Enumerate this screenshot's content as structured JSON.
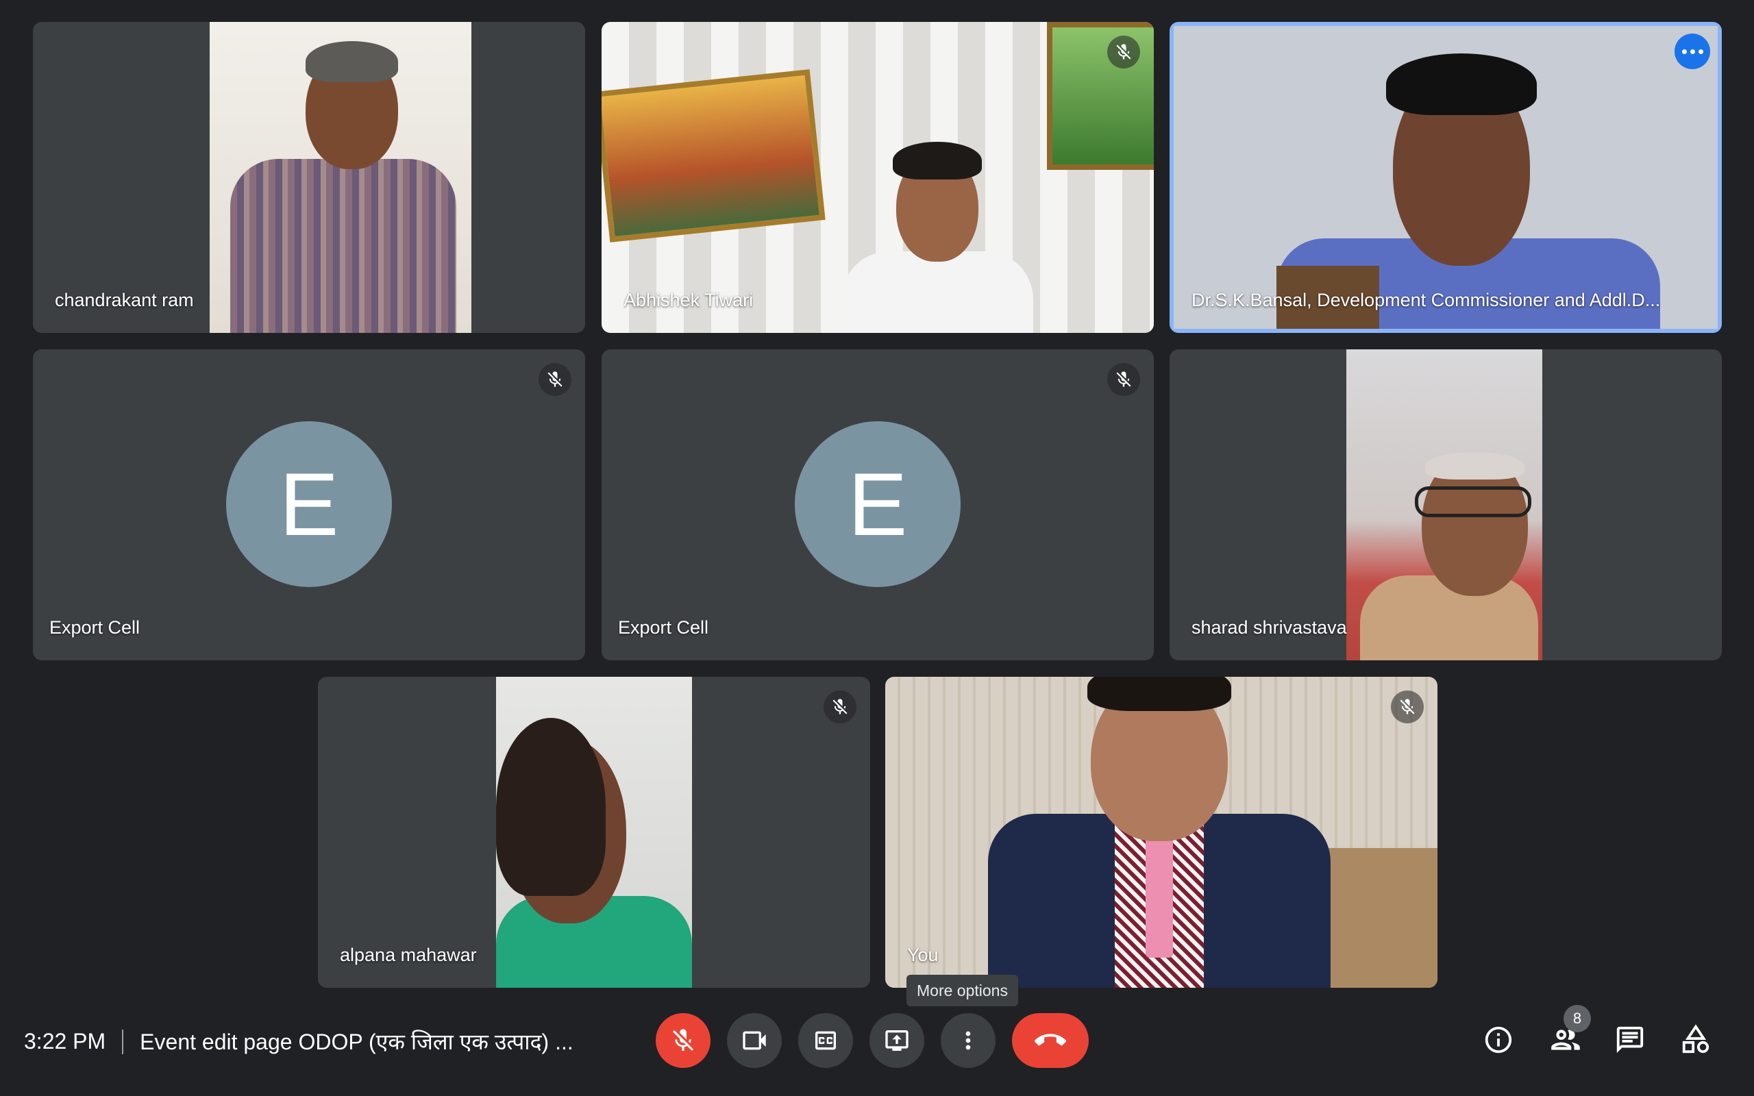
{
  "participants": [
    {
      "name": "chandrakant ram",
      "muted": false,
      "avatar_letter": ""
    },
    {
      "name": "Abhishek Tiwari",
      "muted": true,
      "avatar_letter": ""
    },
    {
      "name": "Dr.S.K.Bansal, Development Commissioner and Addl.D...",
      "muted": false,
      "active_speaker": true,
      "avatar_letter": ""
    },
    {
      "name": "Export Cell",
      "muted": true,
      "avatar_letter": "E"
    },
    {
      "name": "Export Cell",
      "muted": true,
      "avatar_letter": "E"
    },
    {
      "name": "sharad shrivastava",
      "muted": false,
      "avatar_letter": ""
    },
    {
      "name": "alpana mahawar",
      "muted": true,
      "avatar_letter": ""
    },
    {
      "name": "You",
      "muted": true,
      "avatar_letter": ""
    }
  ],
  "meeting": {
    "time": "3:22 PM",
    "title": "Event edit page ODOP (एक जिला एक उत्पाद) ..."
  },
  "controls": {
    "more_options_tooltip": "More options",
    "participants_count": "8"
  },
  "colors": {
    "background": "#202124",
    "tile": "#3c4043",
    "active_border": "#8ab4f8",
    "end_call": "#ea4335",
    "mic_off": "#ea4335",
    "avatar_bg": "#7b94a2",
    "accent_blue": "#1a73e8"
  },
  "icons": {
    "mic": "mic-off-icon",
    "camera": "camera-icon",
    "captions": "captions-icon",
    "present": "present-screen-icon",
    "more": "more-vert-icon",
    "end": "call-end-icon",
    "info": "info-icon",
    "people": "people-icon",
    "chat": "chat-icon",
    "activities": "activities-icon"
  }
}
